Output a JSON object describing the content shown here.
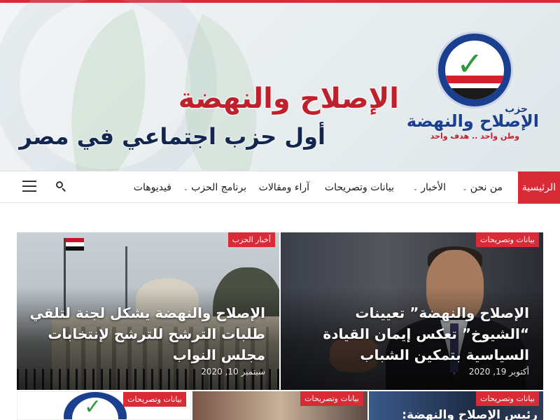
{
  "header": {
    "title": "الإصلاح والنهضة",
    "subtitle": "أول حزب اجتماعي في مصر",
    "logo": {
      "party_word": "حزب",
      "name": "الإصلاح والنهضة",
      "slogan": "وطن واحد .. هدف واحد"
    }
  },
  "nav": {
    "items": [
      {
        "label": "الرئيسية",
        "active": true,
        "dropdown": false
      },
      {
        "label": "من نحن",
        "active": false,
        "dropdown": true
      },
      {
        "label": "الأخبار",
        "active": false,
        "dropdown": true
      },
      {
        "label": "بيانات وتصريحات",
        "active": false,
        "dropdown": false
      },
      {
        "label": "آراء ومقالات",
        "active": false,
        "dropdown": false
      },
      {
        "label": "برنامج الحزب",
        "active": false,
        "dropdown": true
      },
      {
        "label": "فيديوهات",
        "active": false,
        "dropdown": false
      }
    ],
    "icons": [
      "search-icon",
      "menu-icon"
    ]
  },
  "featured": [
    {
      "category": "بيانات وتصريحات",
      "title": "الإصلاح والنهضة” تعيينات “الشيوخ” تعكس إيمان القيادة السياسية بتمكين الشباب",
      "date": "أكتوبر 19, 2020"
    },
    {
      "category": "أخبار الحزب",
      "title": "الإصلاح والنهضة يشكل لجنة لتلقي طلبات الترشح للترشح لإنتخابات مجلس النواب",
      "date": "سبتمبر 10, 2020"
    }
  ],
  "secondary": [
    {
      "category": "بيانات وتصريحات"
    },
    {
      "category": "بيانات وتصريحات"
    },
    {
      "category": "بيانات وتصريحات",
      "title": "رئيس الإصلاح والنهضة:"
    }
  ],
  "colors": {
    "accent": "#d92b36",
    "navy": "#12264f",
    "brand_blue": "#1b3f8f",
    "brand_green": "#2e9a3a"
  }
}
